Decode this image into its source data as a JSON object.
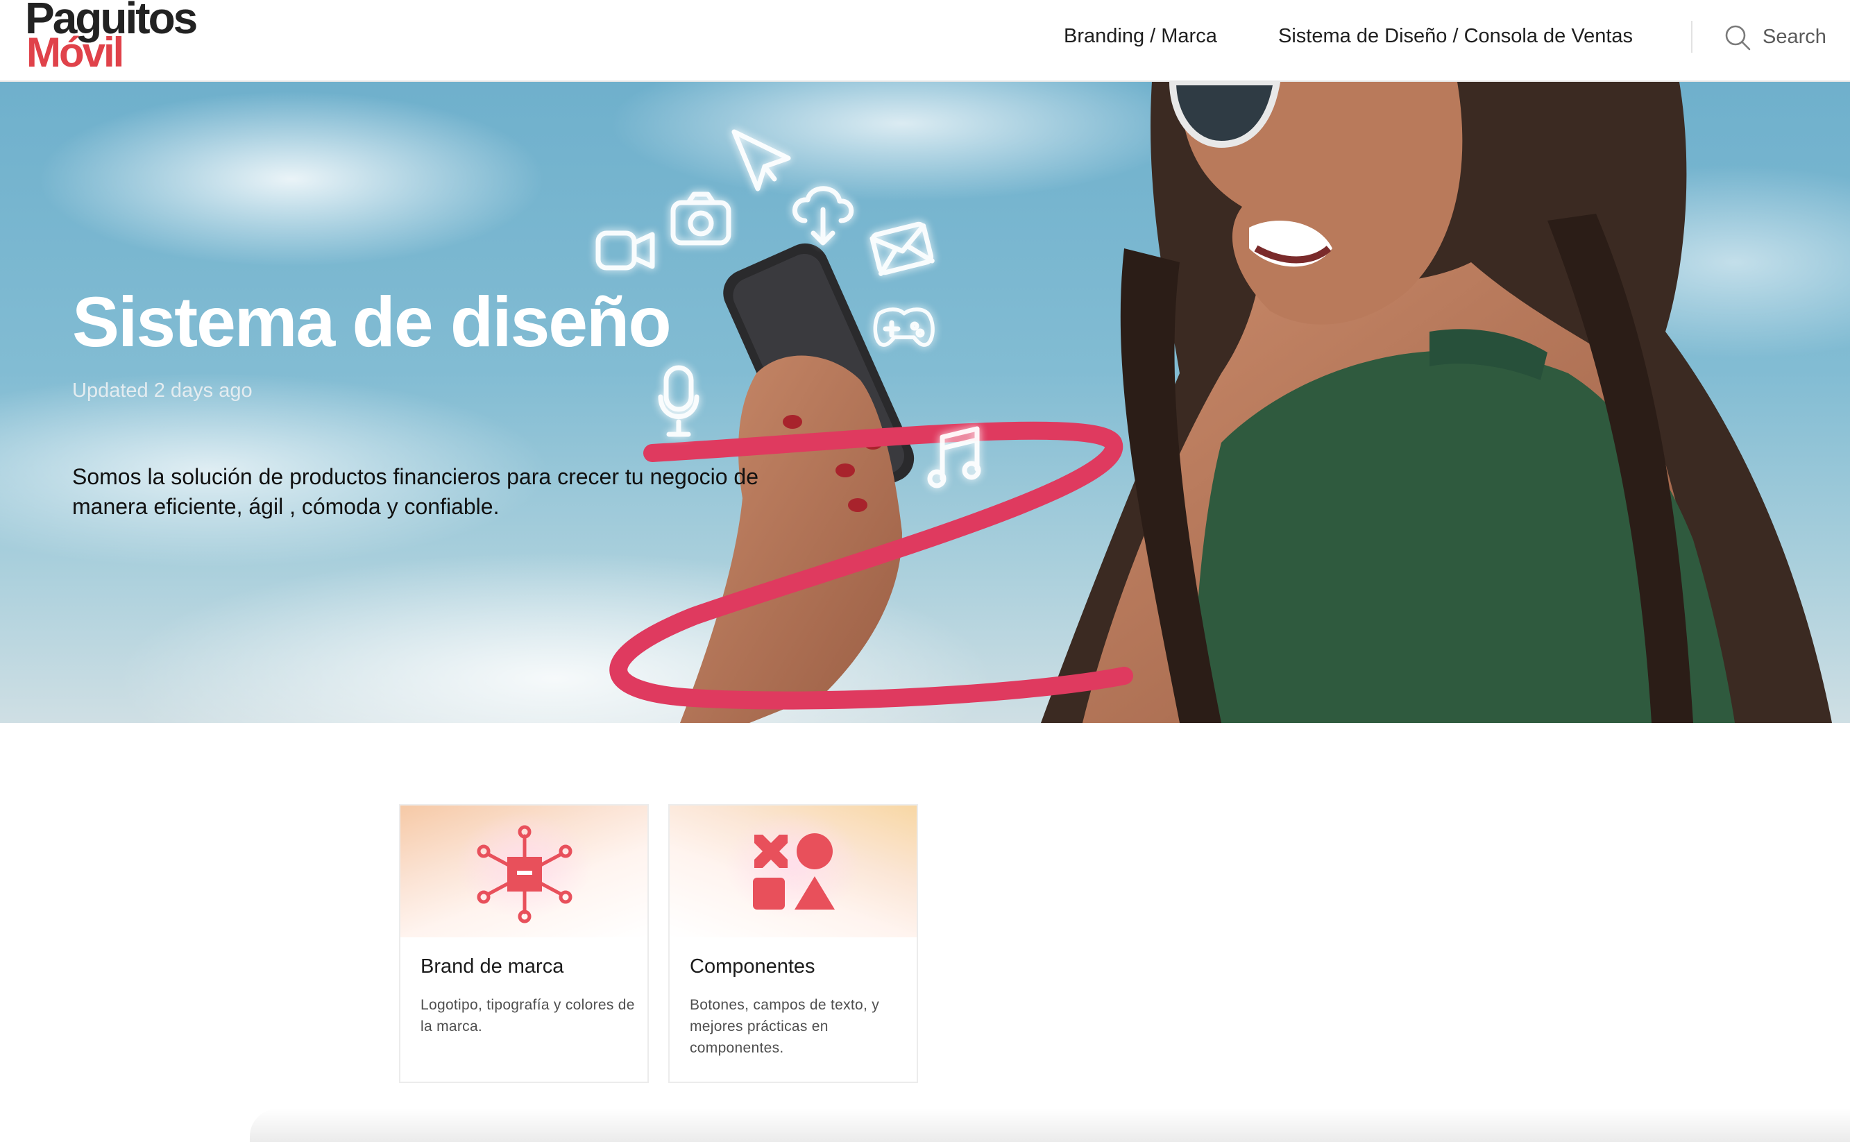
{
  "header": {
    "logo": {
      "line1": "Paguitos",
      "line2": "Móvil"
    },
    "nav": [
      {
        "label": "Branding / Marca"
      },
      {
        "label": "Sistema de Diseño / Consola de Ventas"
      }
    ],
    "search": {
      "label": "Search",
      "icon": "search-icon"
    }
  },
  "hero": {
    "title": "Sistema de diseño",
    "updated": "Updated 2 days ago",
    "description": "Somos la solución de productos financieros para crecer tu negocio de manera eficiente, ágil , cómoda y confiable.",
    "floating_icons": [
      "video-icon",
      "camera-icon",
      "cursor-icon",
      "cloud-download-icon",
      "mail-icon",
      "gamepad-icon",
      "microphone-icon",
      "music-note-icon"
    ]
  },
  "cards": [
    {
      "title": "Brand de marca",
      "description": "Logotipo, tipografía y colores de la marca.",
      "icon": "hub-network-icon"
    },
    {
      "title": "Componentes",
      "description": "Botones, campos de texto, y mejores prácticas en componentes.",
      "icon": "shapes-icon"
    }
  ],
  "colors": {
    "brand_red": "#e0424a",
    "icon_red": "#e8505b",
    "hero_ring": "#df3a5f",
    "text_dark": "#1c1c1c"
  }
}
